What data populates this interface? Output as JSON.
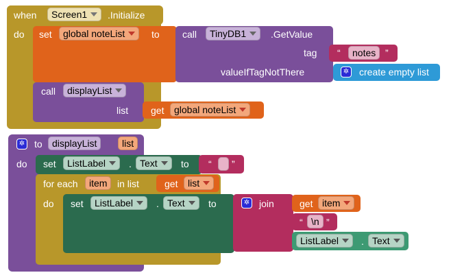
{
  "init_block": {
    "when": "when",
    "screen_component": "Screen1",
    "event": ".Initialize",
    "do": "do",
    "set_word": "set",
    "variable": "global noteList",
    "to_word": "to",
    "call_word": "call",
    "tinydb_component": "TinyDB1",
    "method": ".GetValue",
    "tag_label": "tag",
    "tag_quote_open": "“",
    "tag_value": "notes",
    "tag_quote_close": "”",
    "default_label": "valueIfTagNotThere",
    "default_value": "create empty list",
    "call2_word": "call",
    "procedure_name": "displayList",
    "list_param_label": "list",
    "get_word": "get",
    "get_variable": "global noteList"
  },
  "proc_block": {
    "to_word": "to",
    "name": "displayList",
    "param": "list",
    "do": "do",
    "set_word": "set",
    "component": "ListLabel",
    "dot": ".",
    "property": "Text",
    "to2": "to",
    "empty_quote_open": "“",
    "empty_quote_close": "”",
    "foreach_word": "for each",
    "item_var": "item",
    "in_list": "in list",
    "get_word": "get",
    "get_list": "list",
    "do2": "do",
    "set2_word": "set",
    "component2": "ListLabel",
    "dot2": ".",
    "property2": "Text",
    "to3": "to",
    "join_word": "join",
    "get_item_word": "get",
    "get_item": "item",
    "newline_quote_open": "“",
    "newline_value": "\\n",
    "newline_quote_close": "”",
    "component3": "ListLabel",
    "dot3": ".",
    "property3": "Text"
  },
  "colors": {
    "event": "#b8972a",
    "variable": "#e0631b",
    "tinydb_call": "#7a4f9a",
    "text": "#b32d5e",
    "list": "#2e9ad7",
    "component": "#2b6b4e",
    "component_getter": "#3d9a73"
  }
}
